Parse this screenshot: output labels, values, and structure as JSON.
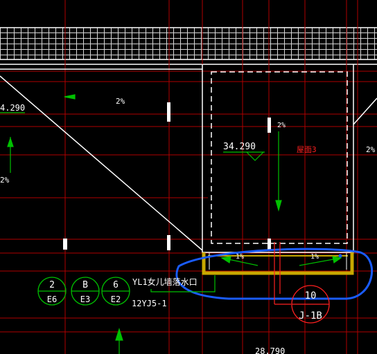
{
  "drawing": {
    "background": "#000000",
    "colors": {
      "grid_red": "#c00000",
      "line_white": "#ffffff",
      "text_white": "#ffffff",
      "arrow_green": "#00c000",
      "label_red": "#ff2020",
      "gutter_yellow": "#c8a800",
      "highlight_blue": "#1a5cff",
      "circle_red": "#ff2020"
    },
    "labels": {
      "elev_left": "4.290",
      "slope_top": "2%",
      "slope_left": "2%",
      "slope_center": "2%",
      "elev_center": "34.290",
      "roof_label": "屋面3",
      "slope_right": "2%",
      "gutter_slope_left": "1%",
      "gutter_slope_right": "1%",
      "drain_note": "YL1女儿墙落水口",
      "detail_ref": "12YJ5-1",
      "elev_bottom": "28.790"
    },
    "callouts": [
      {
        "top": "2",
        "bottom": "E6"
      },
      {
        "top": "B",
        "bottom": "E3"
      },
      {
        "top": "6",
        "bottom": "E2"
      }
    ],
    "detail": {
      "top": "10",
      "bottom": "J-1B"
    }
  }
}
